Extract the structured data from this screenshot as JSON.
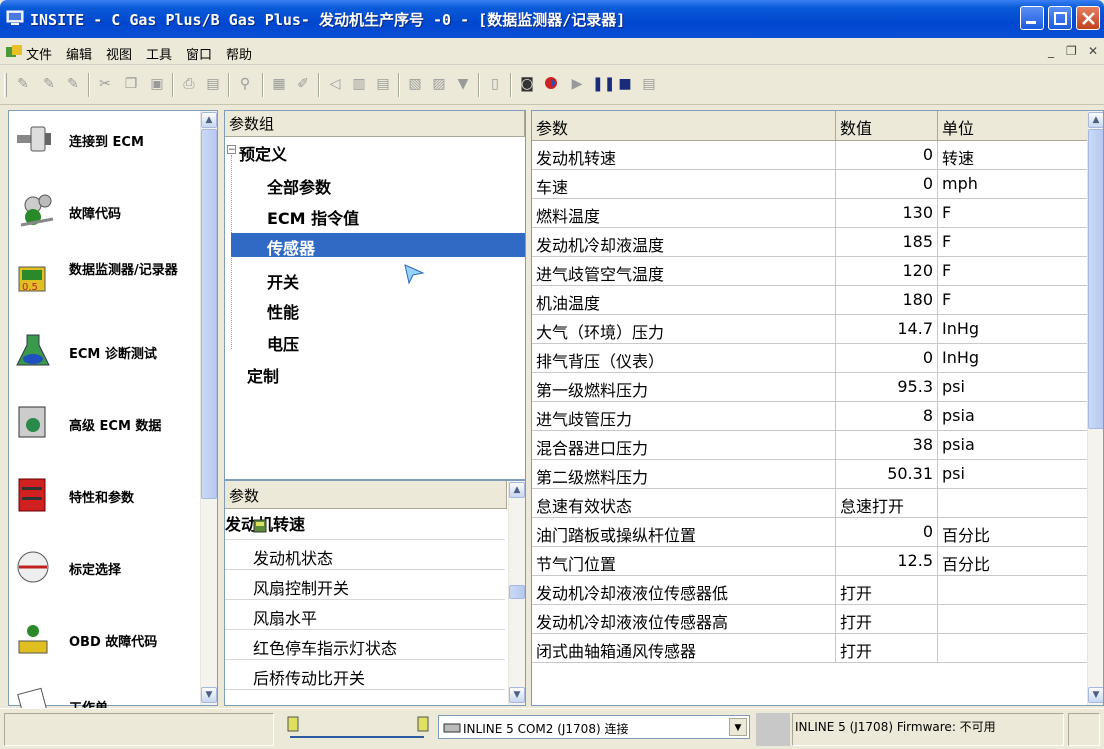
{
  "window": {
    "title": "INSITE - C Gas Plus/B Gas Plus- 发动机生产序号 -0 - [数据监测器/记录器]",
    "controls": [
      "minimize-icon",
      "maximize-icon",
      "close-icon"
    ]
  },
  "menu": {
    "items": [
      "文件",
      "编辑",
      "视图",
      "工具",
      "窗口",
      "帮助"
    ]
  },
  "nav": {
    "items": [
      {
        "label": "连接到 ECM",
        "icon": "connect-ecm-icon"
      },
      {
        "label": "故障代码",
        "icon": "fault-codes-icon"
      },
      {
        "label": "数据监测器/记录器",
        "icon": "data-monitor-icon"
      },
      {
        "label": "ECM 诊断测试",
        "icon": "diagnostic-test-icon"
      },
      {
        "label": "高级 ECM 数据",
        "icon": "advanced-ecm-data-icon"
      },
      {
        "label": "特性和参数",
        "icon": "features-parameters-icon"
      },
      {
        "label": "标定选择",
        "icon": "calibration-select-icon"
      },
      {
        "label": "OBD 故障代码",
        "icon": "obd-fault-codes-icon"
      },
      {
        "label": "工作单",
        "icon": "work-order-icon"
      }
    ]
  },
  "groups": {
    "header": "参数组",
    "predefined": "预定义",
    "children": [
      "全部参数",
      "ECM 指令值",
      "传感器",
      "开关",
      "性能",
      "电压"
    ],
    "selected": "传感器",
    "custom": "定制"
  },
  "params": {
    "header": "参数",
    "items": [
      "发动机转速",
      "发动机状态",
      "风扇控制开关",
      "风扇水平",
      "红色停车指示灯状态",
      "后桥传动比开关"
    ]
  },
  "grid": {
    "columns": [
      "参数",
      "数值",
      "单位"
    ],
    "rows": [
      {
        "param": "发动机转速",
        "value": "0",
        "unit": "转速"
      },
      {
        "param": "车速",
        "value": "0",
        "unit": "mph"
      },
      {
        "param": "燃料温度",
        "value": "130",
        "unit": "F"
      },
      {
        "param": "发动机冷却液温度",
        "value": "185",
        "unit": "F"
      },
      {
        "param": "进气歧管空气温度",
        "value": "120",
        "unit": "F"
      },
      {
        "param": "机油温度",
        "value": "180",
        "unit": "F"
      },
      {
        "param": "大气（环境）压力",
        "value": "14.7",
        "unit": "InHg"
      },
      {
        "param": "排气背压（仪表）",
        "value": "0",
        "unit": "InHg"
      },
      {
        "param": "第一级燃料压力",
        "value": "95.3",
        "unit": "psi"
      },
      {
        "param": "进气歧管压力",
        "value": "8",
        "unit": "psia"
      },
      {
        "param": "混合器进口压力",
        "value": "38",
        "unit": "psia"
      },
      {
        "param": "第二级燃料压力",
        "value": "50.31",
        "unit": "psi"
      },
      {
        "param": "怠速有效状态",
        "value": "怠速打开",
        "unit": ""
      },
      {
        "param": "油门踏板或操纵杆位置",
        "value": "0",
        "unit": "百分比"
      },
      {
        "param": "节气门位置",
        "value": "12.5",
        "unit": "百分比"
      },
      {
        "param": "发动机冷却液液位传感器低",
        "value": "打开",
        "unit": ""
      },
      {
        "param": "发动机冷却液液位传感器高",
        "value": "打开",
        "unit": ""
      },
      {
        "param": "闭式曲轴箱通风传感器",
        "value": "打开",
        "unit": ""
      }
    ]
  },
  "status": {
    "adapter": "INLINE 5 COM2 (J1708) 连接",
    "firmware": "INLINE 5 (J1708) Firmware: 不可用"
  }
}
